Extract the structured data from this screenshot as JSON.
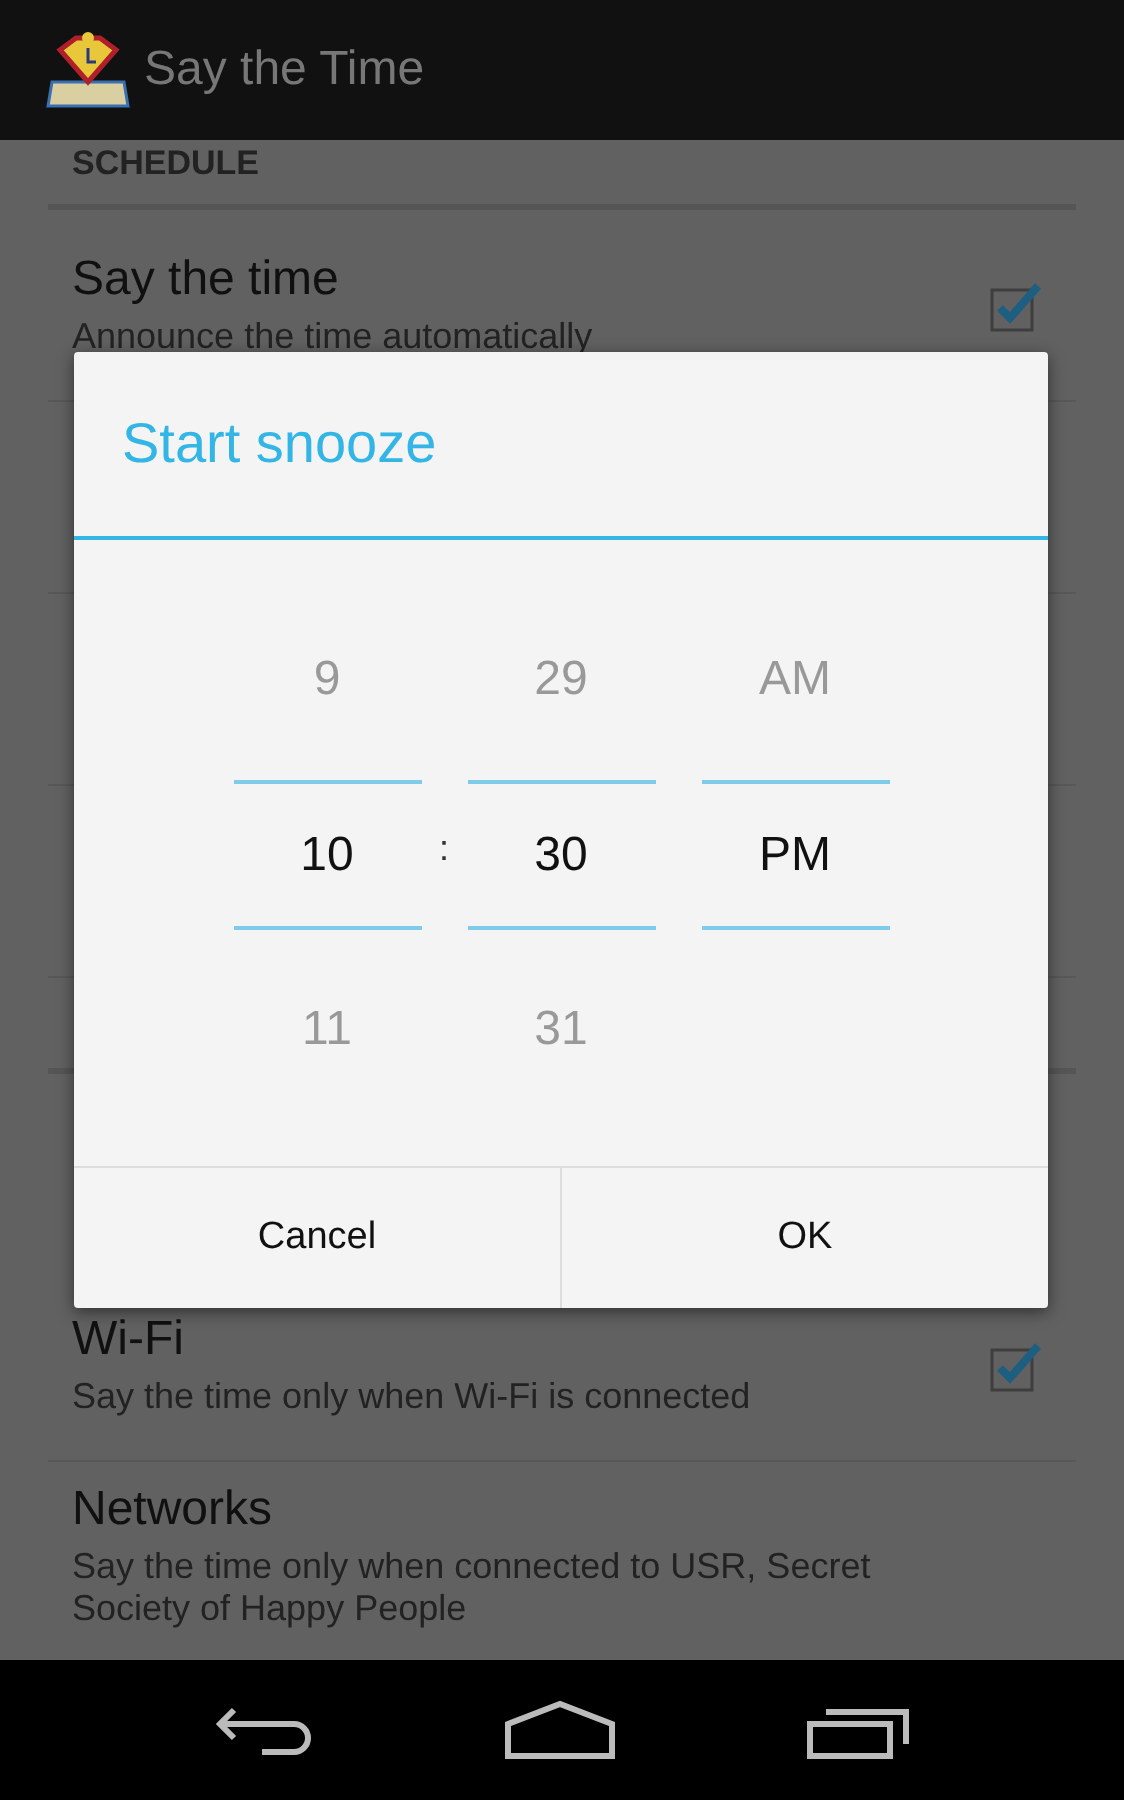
{
  "app_bar": {
    "title": "Say the Time"
  },
  "settings": [
    {
      "kind": "header",
      "title": "SCHEDULE"
    },
    {
      "kind": "checkbox",
      "title": "Say the time",
      "summary": "Announce the time automatically",
      "checked": true
    },
    {
      "kind": "hidden"
    },
    {
      "kind": "checkbox",
      "title": "Wi-Fi",
      "summary": "Say the time only when Wi-Fi is connected",
      "checked": true
    },
    {
      "kind": "text",
      "title": "Networks",
      "summary": "Say the time only when connected to USR, Secret Society of Happy People"
    }
  ],
  "dialog": {
    "title": "Start snooze",
    "separator": ":",
    "columns": [
      {
        "above": "9",
        "value": "10",
        "below": "11"
      },
      {
        "above": "29",
        "value": "30",
        "below": "31"
      },
      {
        "above": "AM",
        "value": "PM"
      }
    ],
    "buttons": [
      "Cancel",
      "OK"
    ]
  }
}
